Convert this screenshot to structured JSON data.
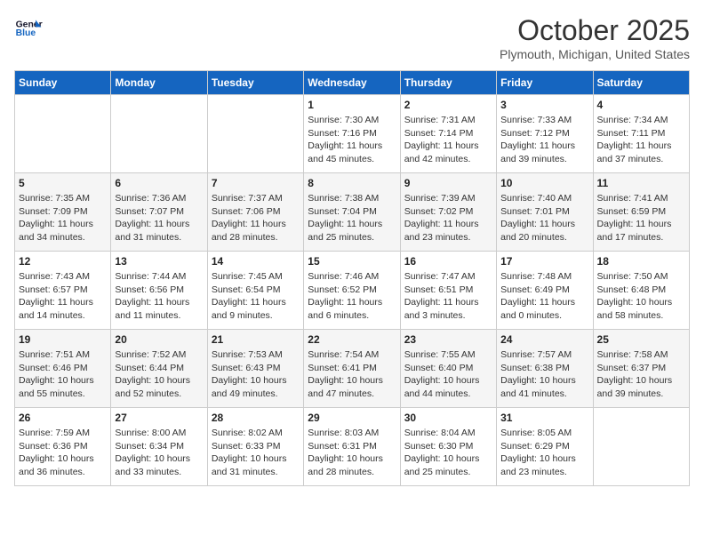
{
  "header": {
    "logo_line1": "General",
    "logo_line2": "Blue",
    "month_title": "October 2025",
    "subtitle": "Plymouth, Michigan, United States"
  },
  "days_of_week": [
    "Sunday",
    "Monday",
    "Tuesday",
    "Wednesday",
    "Thursday",
    "Friday",
    "Saturday"
  ],
  "weeks": [
    [
      {
        "day": "",
        "info": ""
      },
      {
        "day": "",
        "info": ""
      },
      {
        "day": "",
        "info": ""
      },
      {
        "day": "1",
        "info": "Sunrise: 7:30 AM\nSunset: 7:16 PM\nDaylight: 11 hours\nand 45 minutes."
      },
      {
        "day": "2",
        "info": "Sunrise: 7:31 AM\nSunset: 7:14 PM\nDaylight: 11 hours\nand 42 minutes."
      },
      {
        "day": "3",
        "info": "Sunrise: 7:33 AM\nSunset: 7:12 PM\nDaylight: 11 hours\nand 39 minutes."
      },
      {
        "day": "4",
        "info": "Sunrise: 7:34 AM\nSunset: 7:11 PM\nDaylight: 11 hours\nand 37 minutes."
      }
    ],
    [
      {
        "day": "5",
        "info": "Sunrise: 7:35 AM\nSunset: 7:09 PM\nDaylight: 11 hours\nand 34 minutes."
      },
      {
        "day": "6",
        "info": "Sunrise: 7:36 AM\nSunset: 7:07 PM\nDaylight: 11 hours\nand 31 minutes."
      },
      {
        "day": "7",
        "info": "Sunrise: 7:37 AM\nSunset: 7:06 PM\nDaylight: 11 hours\nand 28 minutes."
      },
      {
        "day": "8",
        "info": "Sunrise: 7:38 AM\nSunset: 7:04 PM\nDaylight: 11 hours\nand 25 minutes."
      },
      {
        "day": "9",
        "info": "Sunrise: 7:39 AM\nSunset: 7:02 PM\nDaylight: 11 hours\nand 23 minutes."
      },
      {
        "day": "10",
        "info": "Sunrise: 7:40 AM\nSunset: 7:01 PM\nDaylight: 11 hours\nand 20 minutes."
      },
      {
        "day": "11",
        "info": "Sunrise: 7:41 AM\nSunset: 6:59 PM\nDaylight: 11 hours\nand 17 minutes."
      }
    ],
    [
      {
        "day": "12",
        "info": "Sunrise: 7:43 AM\nSunset: 6:57 PM\nDaylight: 11 hours\nand 14 minutes."
      },
      {
        "day": "13",
        "info": "Sunrise: 7:44 AM\nSunset: 6:56 PM\nDaylight: 11 hours\nand 11 minutes."
      },
      {
        "day": "14",
        "info": "Sunrise: 7:45 AM\nSunset: 6:54 PM\nDaylight: 11 hours\nand 9 minutes."
      },
      {
        "day": "15",
        "info": "Sunrise: 7:46 AM\nSunset: 6:52 PM\nDaylight: 11 hours\nand 6 minutes."
      },
      {
        "day": "16",
        "info": "Sunrise: 7:47 AM\nSunset: 6:51 PM\nDaylight: 11 hours\nand 3 minutes."
      },
      {
        "day": "17",
        "info": "Sunrise: 7:48 AM\nSunset: 6:49 PM\nDaylight: 11 hours\nand 0 minutes."
      },
      {
        "day": "18",
        "info": "Sunrise: 7:50 AM\nSunset: 6:48 PM\nDaylight: 10 hours\nand 58 minutes."
      }
    ],
    [
      {
        "day": "19",
        "info": "Sunrise: 7:51 AM\nSunset: 6:46 PM\nDaylight: 10 hours\nand 55 minutes."
      },
      {
        "day": "20",
        "info": "Sunrise: 7:52 AM\nSunset: 6:44 PM\nDaylight: 10 hours\nand 52 minutes."
      },
      {
        "day": "21",
        "info": "Sunrise: 7:53 AM\nSunset: 6:43 PM\nDaylight: 10 hours\nand 49 minutes."
      },
      {
        "day": "22",
        "info": "Sunrise: 7:54 AM\nSunset: 6:41 PM\nDaylight: 10 hours\nand 47 minutes."
      },
      {
        "day": "23",
        "info": "Sunrise: 7:55 AM\nSunset: 6:40 PM\nDaylight: 10 hours\nand 44 minutes."
      },
      {
        "day": "24",
        "info": "Sunrise: 7:57 AM\nSunset: 6:38 PM\nDaylight: 10 hours\nand 41 minutes."
      },
      {
        "day": "25",
        "info": "Sunrise: 7:58 AM\nSunset: 6:37 PM\nDaylight: 10 hours\nand 39 minutes."
      }
    ],
    [
      {
        "day": "26",
        "info": "Sunrise: 7:59 AM\nSunset: 6:36 PM\nDaylight: 10 hours\nand 36 minutes."
      },
      {
        "day": "27",
        "info": "Sunrise: 8:00 AM\nSunset: 6:34 PM\nDaylight: 10 hours\nand 33 minutes."
      },
      {
        "day": "28",
        "info": "Sunrise: 8:02 AM\nSunset: 6:33 PM\nDaylight: 10 hours\nand 31 minutes."
      },
      {
        "day": "29",
        "info": "Sunrise: 8:03 AM\nSunset: 6:31 PM\nDaylight: 10 hours\nand 28 minutes."
      },
      {
        "day": "30",
        "info": "Sunrise: 8:04 AM\nSunset: 6:30 PM\nDaylight: 10 hours\nand 25 minutes."
      },
      {
        "day": "31",
        "info": "Sunrise: 8:05 AM\nSunset: 6:29 PM\nDaylight: 10 hours\nand 23 minutes."
      },
      {
        "day": "",
        "info": ""
      }
    ]
  ]
}
